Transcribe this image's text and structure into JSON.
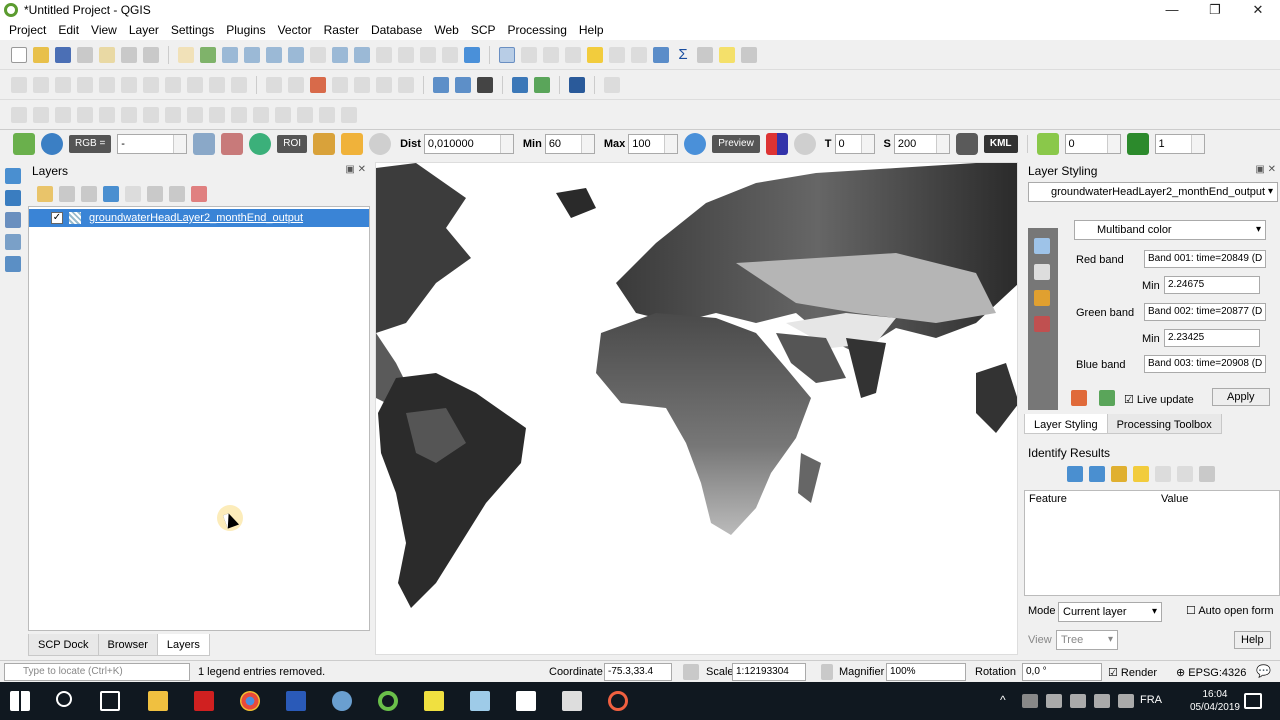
{
  "window": {
    "title": "*Untitled Project - QGIS",
    "minimize": "—",
    "maximize": "❐",
    "close": "✕"
  },
  "menu": [
    "Project",
    "Edit",
    "View",
    "Layer",
    "Settings",
    "Plugins",
    "Vector",
    "Raster",
    "Database",
    "Web",
    "SCP",
    "Processing",
    "Help"
  ],
  "scp_toolbar": {
    "rgb_label": "RGB =",
    "rgb_value": "-",
    "roi_label": "ROI",
    "dist_label": "Dist",
    "dist_value": "0,010000",
    "min_label": "Min",
    "min_value": "60",
    "max_label": "Max",
    "max_value": "100",
    "preview_label": "Preview",
    "t_label": "T",
    "t_value": "0",
    "s_label": "S",
    "s_value": "200",
    "kml_label": "KML",
    "band_value1": "0",
    "band_value2": "1"
  },
  "layers_panel": {
    "title": "Layers",
    "layer_name": "groundwaterHeadLayer2_monthEnd_output",
    "layer_checked": "✓",
    "tabs": [
      "SCP Dock",
      "Browser",
      "Layers"
    ]
  },
  "layer_styling": {
    "title": "Layer Styling",
    "layer_combo": "groundwaterHeadLayer2_monthEnd_output",
    "renderer": "Multiband color",
    "red_band_label": "Red band",
    "red_band_value": "Band 001: time=20849 (D",
    "red_min_label": "Min",
    "red_min_value": "2.24675",
    "green_band_label": "Green band",
    "green_band_value": "Band 002: time=20877 (D",
    "green_min_label": "Min",
    "green_min_value": "2.23425",
    "blue_band_label": "Blue band",
    "blue_band_value": "Band 003: time=20908 (D",
    "live_update_label": "Live update",
    "apply_label": "Apply",
    "tabs": [
      "Layer Styling",
      "Processing Toolbox"
    ]
  },
  "identify": {
    "title": "Identify Results",
    "col_feature": "Feature",
    "col_value": "Value",
    "mode_label": "Mode",
    "mode_value": "Current layer",
    "auto_open_label": "Auto open form",
    "view_label": "View",
    "view_value": "Tree",
    "help_label": "Help"
  },
  "status": {
    "locate_placeholder": "Type to locate (Ctrl+K)",
    "message": "1 legend entries removed.",
    "coordinate_label": "Coordinate",
    "coordinate_value": "-75.3,33.4",
    "scale_label": "Scale",
    "scale_value": "1:12193304",
    "magnifier_label": "Magnifier",
    "magnifier_value": "100%",
    "rotation_label": "Rotation",
    "rotation_value": "0,0 °",
    "render_label": "Render",
    "crs_label": "EPSG:4326"
  },
  "taskbar": {
    "language": "FRA",
    "time": "16:04",
    "date": "05/04/2019"
  },
  "colors": {
    "selection": "#3a84d6",
    "taskbar": "#101820",
    "qgis_green": "#5b9b2f"
  }
}
